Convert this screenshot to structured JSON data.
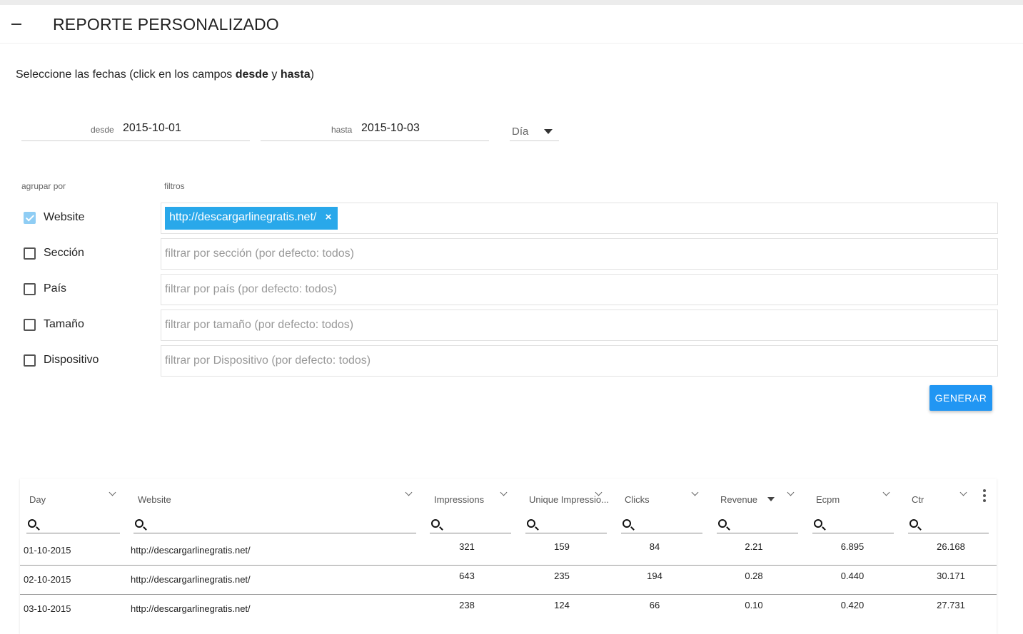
{
  "header": {
    "title": "REPORTE PERSONALIZADO"
  },
  "instructions": {
    "prefix": "Seleccione las fechas (click en los campos ",
    "desde": "desde",
    "mid": " y ",
    "hasta": "hasta",
    "suffix": ")"
  },
  "dates": {
    "desde_label": "desde",
    "desde_value": "2015-10-01",
    "hasta_label": "hasta",
    "hasta_value": "2015-10-03",
    "granularity": "Día"
  },
  "group_label": "agrupar por",
  "filter_label": "filtros",
  "groups": [
    {
      "label": "Website",
      "checked": true
    },
    {
      "label": "Sección",
      "checked": false
    },
    {
      "label": "País",
      "checked": false
    },
    {
      "label": "Tamaño",
      "checked": false
    },
    {
      "label": "Dispositivo",
      "checked": false
    }
  ],
  "filters": {
    "website_chip": "http://descargarlinegratis.net/",
    "chip_remove": "×",
    "seccion_placeholder": "filtrar por sección (por defecto: todos)",
    "pais_placeholder": "filtrar por país (por defecto: todos)",
    "tamano_placeholder": "filtrar por tamaño (por defecto: todos)",
    "dispositivo_placeholder": "filtrar por Dispositivo (por defecto: todos)"
  },
  "generate_label": "GENERAR",
  "grid": {
    "columns": [
      "Day",
      "Website",
      "Impressions",
      "Unique Impressio...",
      "Clicks",
      "Revenue",
      "Ecpm",
      "Ctr"
    ],
    "rows": [
      [
        "01-10-2015",
        "http://descargarlinegratis.net/",
        "321",
        "159",
        "84",
        "2.21",
        "6.895",
        "26.168"
      ],
      [
        "02-10-2015",
        "http://descargarlinegratis.net/",
        "643",
        "235",
        "194",
        "0.28",
        "0.440",
        "30.171"
      ],
      [
        "03-10-2015",
        "http://descargarlinegratis.net/",
        "238",
        "124",
        "66",
        "0.10",
        "0.420",
        "27.731"
      ]
    ]
  }
}
